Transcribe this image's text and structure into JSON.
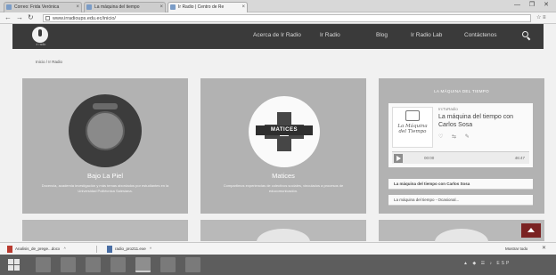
{
  "browser": {
    "tabs": [
      {
        "label": "Correo: Frida Verónica",
        "active": false
      },
      {
        "label": "La máquina del tiempo",
        "active": false
      },
      {
        "label": "Ir Radio | Centro de Re",
        "active": true
      }
    ],
    "window_controls": "—  ❐  ✕",
    "url": "www.irradioups.edu.ec/inicio/",
    "nav_icons": [
      "arrow-left-icon",
      "arrow-right-icon",
      "reload-icon"
    ],
    "extension_icons": "☆ ≡"
  },
  "site": {
    "logo_subtext": "ir radio",
    "nav": [
      "Acerca de Ir Radio",
      "Ir Radio",
      "Blog",
      "Ir Radio Lab",
      "Contáctenos"
    ],
    "breadcrumb": "Inicio / Ir Radio",
    "cards": [
      {
        "title": "Bajo La Piel",
        "description": "Docencia, academia investigación y más temas abordados por estudiantes en la Universidad Politécnica Salesiana."
      },
      {
        "title": "Matices",
        "emblem_text": "MATICES",
        "description": "Compartimos experiencias de colectivos sociales, vinculados a procesos de educomunicación."
      },
      {
        "widget_header": "LA MÁQUINA DEL TIEMPO",
        "player": {
          "user": "IrcTuRadio",
          "title": "La máquina del tiempo con Carlos Sosa",
          "cover_text": "La Máquina del Tiempo",
          "time_current": "00:00",
          "time_total": "46:47",
          "icons": "♡ ⇆ ✎"
        },
        "playlist": [
          "La máquina del tiempo con Carlos Sosa",
          "La máquina del tiempo - Ocasional..."
        ]
      }
    ]
  },
  "downloads": {
    "items": [
      {
        "name": "Analisis_de_prege...docx"
      },
      {
        "name": "radio_pro211.exe"
      }
    ],
    "show_all": "Mostrar todo",
    "close": "✕"
  },
  "taskbar": {
    "tray": "▲ ◆ ☰ ♪ ESP"
  },
  "colors": {
    "site_header": "#3a3a3a",
    "card_bg": "#b2b2b2",
    "scroll_top": "#7a2222",
    "taskbar": "#5d5d5d"
  }
}
